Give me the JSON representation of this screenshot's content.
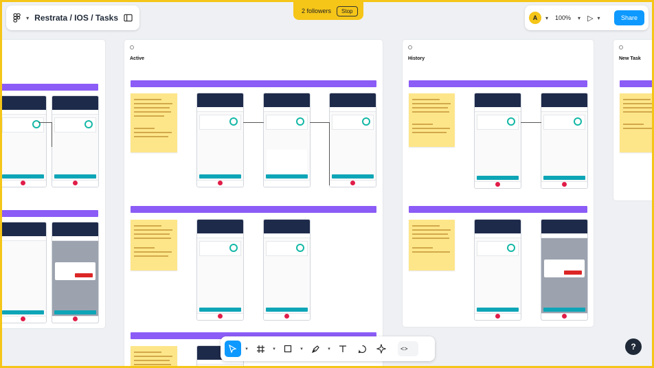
{
  "header": {
    "breadcrumb": "Restrata / IOS / Tasks",
    "followers_label": "2 followers",
    "stop_label": "Stop",
    "avatar_initial": "A",
    "zoom_label": "100%",
    "share_label": "Share"
  },
  "boards": {
    "active": {
      "title": "Active"
    },
    "history": {
      "title": "History"
    },
    "new_task": {
      "title": "New Task"
    }
  },
  "toolbar": {
    "tools": [
      "move-tool",
      "frame-tool",
      "shape-tool",
      "pen-tool",
      "text-tool",
      "comment-tool",
      "actions-tool"
    ],
    "dev_mode_icon": "code-icon"
  },
  "help": {
    "label": "?"
  },
  "colors": {
    "accent": "#0d99ff",
    "followers": "#f5c518",
    "flow_bar": "#8b5cf6",
    "sticky": "#fde68a",
    "phone_header": "#1e2a4a"
  }
}
